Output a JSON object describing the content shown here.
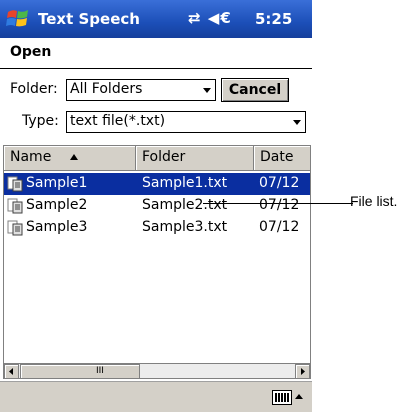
{
  "title_bar": {
    "app_title": "Text Speech",
    "clock": "5:25",
    "sys_icons": "⇄ ◀€"
  },
  "header": {
    "menu_label": "Open"
  },
  "folder": {
    "label": "Folder:",
    "value": "All Folders"
  },
  "cancel_label": "Cancel",
  "type": {
    "label": "Type:",
    "value": "text file(*.txt)"
  },
  "list": {
    "columns": [
      "Name",
      "Folder",
      "Date"
    ],
    "rows": [
      {
        "name": "Sample1",
        "folder": "Sample1.txt",
        "date": "07/12",
        "selected": true
      },
      {
        "name": "Sample2",
        "folder": "Sample2.txt",
        "date": "07/12",
        "selected": false
      },
      {
        "name": "Sample3",
        "folder": "Sample3.txt",
        "date": "07/12",
        "selected": false
      }
    ]
  },
  "callout": "File list.",
  "colors": {
    "title_bar": "#1c4fb8",
    "selection": "#0a2ea0",
    "chrome": "#d4d0c8"
  }
}
